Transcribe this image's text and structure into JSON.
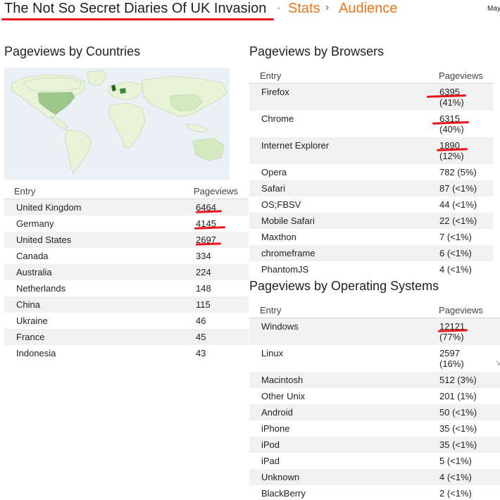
{
  "header": {
    "blog_title": "The Not So Secret Diaries Of UK Invasion",
    "separator": "·",
    "crumb_stats": "Stats",
    "crumb_chevron": "›",
    "crumb_audience": "Audience",
    "date_truncated": "May"
  },
  "countries": {
    "title": "Pageviews by Countries",
    "col_entry": "Entry",
    "col_pageviews": "Pageviews",
    "rows": [
      {
        "entry": "United Kingdom",
        "pageviews": "6464"
      },
      {
        "entry": "Germany",
        "pageviews": "4145"
      },
      {
        "entry": "United States",
        "pageviews": "2697"
      },
      {
        "entry": "Canada",
        "pageviews": "334"
      },
      {
        "entry": "Australia",
        "pageviews": "224"
      },
      {
        "entry": "Netherlands",
        "pageviews": "148"
      },
      {
        "entry": "China",
        "pageviews": "115"
      },
      {
        "entry": "Ukraine",
        "pageviews": "46"
      },
      {
        "entry": "France",
        "pageviews": "45"
      },
      {
        "entry": "Indonesia",
        "pageviews": "43"
      }
    ]
  },
  "browsers": {
    "title": "Pageviews by Browsers",
    "col_entry": "Entry",
    "col_pageviews": "Pageviews",
    "rows": [
      {
        "entry": "Firefox",
        "pageviews": "6395",
        "pct": "(41%)"
      },
      {
        "entry": "Chrome",
        "pageviews": "6315",
        "pct": "(40%)"
      },
      {
        "entry": "Internet Explorer",
        "pageviews": "1890",
        "pct": "(12%)"
      },
      {
        "entry": "Opera",
        "pageviews": "782 (5%)"
      },
      {
        "entry": "Safari",
        "pageviews": "87 (<1%)"
      },
      {
        "entry": "OS;FBSV",
        "pageviews": "44 (<1%)"
      },
      {
        "entry": "Mobile Safari",
        "pageviews": "22 (<1%)"
      },
      {
        "entry": "Maxthon",
        "pageviews": "7 (<1%)"
      },
      {
        "entry": "chromeframe",
        "pageviews": "6 (<1%)"
      },
      {
        "entry": "PhantomJS",
        "pageviews": "4 (<1%)"
      }
    ]
  },
  "os": {
    "title": "Pageviews by Operating Systems",
    "col_entry": "Entry",
    "col_pageviews": "Pageviews",
    "rows": [
      {
        "entry": "Windows",
        "pageviews": "12121",
        "pct": "(77%)"
      },
      {
        "entry": "Linux",
        "pageviews": "2597",
        "pct": "(16%)"
      },
      {
        "entry": "Macintosh",
        "pageviews": "512 (3%)"
      },
      {
        "entry": "Other Unix",
        "pageviews": "201 (1%)"
      },
      {
        "entry": "Android",
        "pageviews": "50 (<1%)"
      },
      {
        "entry": "iPhone",
        "pageviews": "35 (<1%)"
      },
      {
        "entry": "iPod",
        "pageviews": "35 (<1%)"
      },
      {
        "entry": "iPad",
        "pageviews": "5 (<1%)"
      },
      {
        "entry": "Unknown",
        "pageviews": "4 (<1%)"
      },
      {
        "entry": "BlackBerry",
        "pageviews": "2 (<1%)"
      }
    ]
  },
  "edge_fragment": "V",
  "colors": {
    "accent_orange": "#e8751a",
    "annotation_red": "#e8141c",
    "row_alt": "#f1f1f1",
    "map_high": "#1f6a1f",
    "map_mid": "#9cc98a",
    "map_low": "#e7f4d6",
    "map_ocean": "#eaf1f5"
  }
}
